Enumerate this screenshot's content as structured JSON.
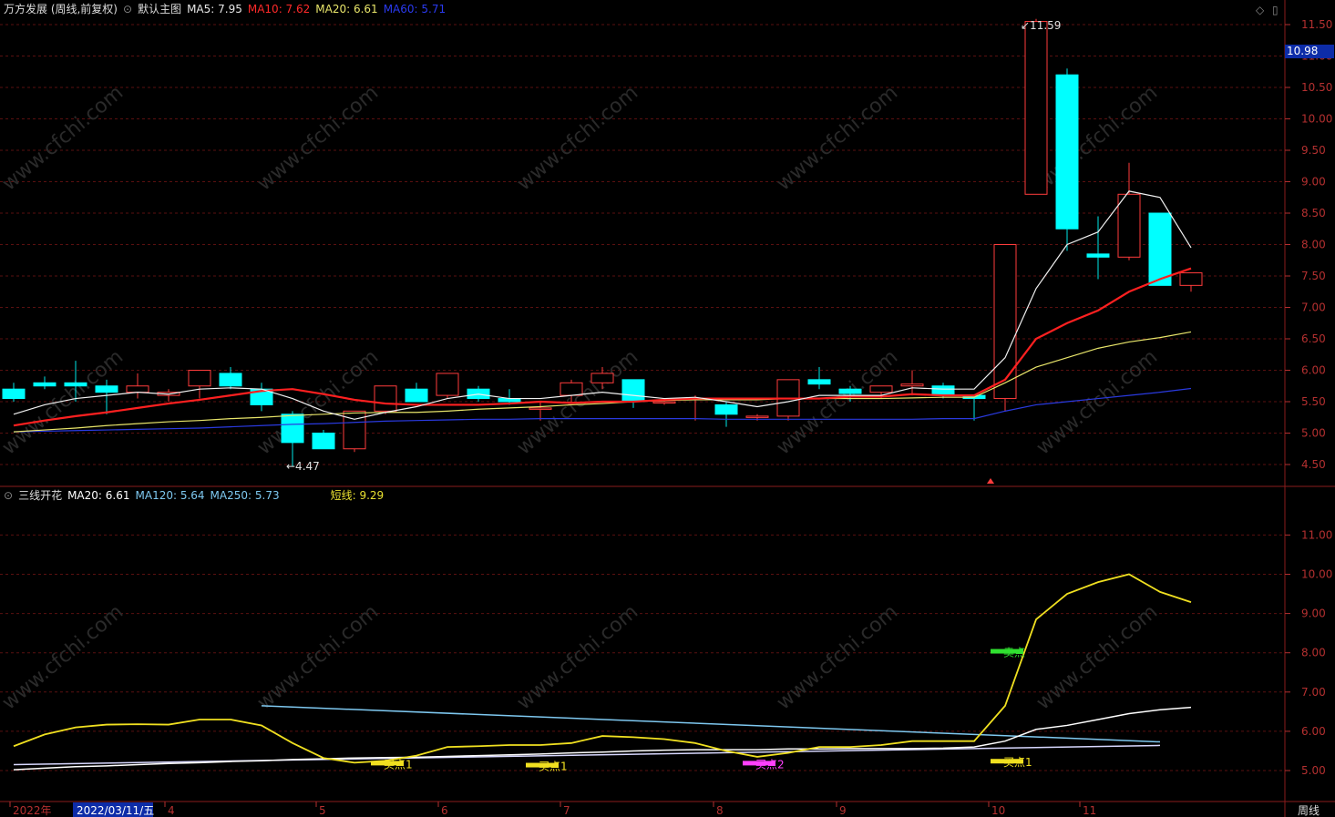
{
  "main_panel": {
    "stock_name": "万方发展 (周线,前复权)",
    "template": "默认主图",
    "ma5": {
      "label": "MA5: 7.95",
      "color": "#e8e8e8"
    },
    "ma10": {
      "label": "MA10: 7.62",
      "color": "#ff2a2a"
    },
    "ma20": {
      "label": "MA20: 6.61",
      "color": "#e8e56a"
    },
    "ma60": {
      "label": "MA60: 5.71",
      "color": "#1c2fd8"
    },
    "high_label": "11.59",
    "low_label": "4.47",
    "current_price": "10.98",
    "y_ticks": [
      "11.50",
      "11.00",
      "10.50",
      "10.00",
      "9.50",
      "9.00",
      "8.50",
      "8.00",
      "7.50",
      "7.00",
      "6.50",
      "6.00",
      "5.50",
      "5.00",
      "4.50"
    ]
  },
  "sub_panel": {
    "indicator": "三线开花",
    "ma20": "MA20: 6.61",
    "ma120": "MA120: 5.64",
    "ma250": "MA250: 5.73",
    "short": "短线: 9.29",
    "y_ticks": [
      "11.00",
      "10.00",
      "9.00",
      "8.00",
      "7.00",
      "6.00",
      "5.00"
    ],
    "signals": [
      "买点1",
      "买点1",
      "买点2",
      "卖点",
      "买点1"
    ]
  },
  "x_axis": {
    "labels": [
      "2022年",
      "2022/03/11/五",
      "4",
      "5",
      "6",
      "7",
      "8",
      "9",
      "10",
      "11"
    ],
    "period": "周线"
  },
  "watermark": "www.cfchi.com",
  "chart_data": {
    "type": "candlestick",
    "candles": [
      {
        "o": 5.7,
        "h": 5.8,
        "l": 5.5,
        "c": 5.55
      },
      {
        "o": 5.8,
        "h": 5.9,
        "l": 5.7,
        "c": 5.75
      },
      {
        "o": 5.8,
        "h": 6.15,
        "l": 5.5,
        "c": 5.75
      },
      {
        "o": 5.75,
        "h": 5.85,
        "l": 5.3,
        "c": 5.65
      },
      {
        "o": 5.65,
        "h": 5.95,
        "l": 5.55,
        "c": 5.75
      },
      {
        "o": 5.6,
        "h": 5.7,
        "l": 5.5,
        "c": 5.65
      },
      {
        "o": 5.75,
        "h": 6.0,
        "l": 5.55,
        "c": 6.0
      },
      {
        "o": 5.95,
        "h": 6.05,
        "l": 5.7,
        "c": 5.75
      },
      {
        "o": 5.7,
        "h": 5.8,
        "l": 5.35,
        "c": 5.45
      },
      {
        "o": 5.3,
        "h": 5.35,
        "l": 4.47,
        "c": 4.85
      },
      {
        "o": 5.0,
        "h": 5.05,
        "l": 4.75,
        "c": 4.75
      },
      {
        "o": 4.75,
        "h": 5.3,
        "l": 4.7,
        "c": 5.35
      },
      {
        "o": 5.35,
        "h": 5.75,
        "l": 5.3,
        "c": 5.75
      },
      {
        "o": 5.7,
        "h": 5.8,
        "l": 5.5,
        "c": 5.5
      },
      {
        "o": 5.6,
        "h": 5.95,
        "l": 5.55,
        "c": 5.95
      },
      {
        "o": 5.7,
        "h": 5.75,
        "l": 5.5,
        "c": 5.55
      },
      {
        "o": 5.55,
        "h": 5.7,
        "l": 5.45,
        "c": 5.5
      },
      {
        "o": 5.4,
        "h": 5.5,
        "l": 5.2,
        "c": 5.4
      },
      {
        "o": 5.6,
        "h": 5.85,
        "l": 5.5,
        "c": 5.8
      },
      {
        "o": 5.8,
        "h": 6.05,
        "l": 5.7,
        "c": 5.95
      },
      {
        "o": 5.85,
        "h": 5.85,
        "l": 5.4,
        "c": 5.5
      },
      {
        "o": 5.5,
        "h": 5.55,
        "l": 5.45,
        "c": 5.5
      },
      {
        "o": 5.55,
        "h": 5.6,
        "l": 5.2,
        "c": 5.55
      },
      {
        "o": 5.45,
        "h": 5.5,
        "l": 5.1,
        "c": 5.3
      },
      {
        "o": 5.25,
        "h": 5.3,
        "l": 5.2,
        "c": 5.27
      },
      {
        "o": 5.27,
        "h": 5.85,
        "l": 5.2,
        "c": 5.85
      },
      {
        "o": 5.85,
        "h": 6.05,
        "l": 5.7,
        "c": 5.78
      },
      {
        "o": 5.7,
        "h": 5.75,
        "l": 5.5,
        "c": 5.63
      },
      {
        "o": 5.65,
        "h": 5.75,
        "l": 5.55,
        "c": 5.75
      },
      {
        "o": 5.75,
        "h": 6.0,
        "l": 5.6,
        "c": 5.78
      },
      {
        "o": 5.75,
        "h": 5.8,
        "l": 5.55,
        "c": 5.6
      },
      {
        "o": 5.6,
        "h": 5.6,
        "l": 5.2,
        "c": 5.55
      },
      {
        "o": 5.55,
        "h": 8.0,
        "l": 5.35,
        "c": 8.0
      },
      {
        "o": 8.8,
        "h": 11.59,
        "l": 8.8,
        "c": 11.55
      },
      {
        "o": 10.7,
        "h": 10.8,
        "l": 7.9,
        "c": 8.25
      },
      {
        "o": 7.85,
        "h": 8.45,
        "l": 7.45,
        "c": 7.8
      },
      {
        "o": 7.8,
        "h": 9.3,
        "l": 7.75,
        "c": 8.8
      },
      {
        "o": 8.5,
        "h": 8.5,
        "l": 7.35,
        "c": 7.35
      },
      {
        "o": 7.35,
        "h": 7.55,
        "l": 7.25,
        "c": 7.55
      }
    ],
    "ma5": [
      5.3,
      5.45,
      5.55,
      5.6,
      5.65,
      5.62,
      5.7,
      5.72,
      5.7,
      5.55,
      5.35,
      5.22,
      5.33,
      5.42,
      5.55,
      5.62,
      5.55,
      5.55,
      5.6,
      5.65,
      5.6,
      5.55,
      5.57,
      5.5,
      5.42,
      5.5,
      5.6,
      5.6,
      5.6,
      5.72,
      5.7,
      5.7,
      6.2,
      7.3,
      8.0,
      8.2,
      8.85,
      8.75,
      7.95
    ],
    "ma10": [
      5.12,
      5.2,
      5.27,
      5.33,
      5.4,
      5.47,
      5.53,
      5.6,
      5.67,
      5.7,
      5.62,
      5.53,
      5.47,
      5.45,
      5.45,
      5.45,
      5.47,
      5.5,
      5.48,
      5.5,
      5.5,
      5.53,
      5.55,
      5.55,
      5.55,
      5.55,
      5.55,
      5.58,
      5.58,
      5.62,
      5.6,
      5.6,
      5.85,
      6.5,
      6.75,
      6.95,
      7.25,
      7.45,
      7.62
    ],
    "ma20": [
      5.02,
      5.05,
      5.08,
      5.12,
      5.15,
      5.18,
      5.2,
      5.23,
      5.25,
      5.28,
      5.3,
      5.32,
      5.33,
      5.33,
      5.35,
      5.38,
      5.4,
      5.42,
      5.45,
      5.47,
      5.5,
      5.52,
      5.53,
      5.53,
      5.53,
      5.55,
      5.55,
      5.55,
      5.55,
      5.56,
      5.57,
      5.57,
      5.8,
      6.05,
      6.2,
      6.35,
      6.45,
      6.52,
      6.61
    ],
    "ma60": [
      5.02,
      5.03,
      5.04,
      5.05,
      5.06,
      5.07,
      5.08,
      5.1,
      5.12,
      5.14,
      5.15,
      5.17,
      5.19,
      5.2,
      5.21,
      5.22,
      5.22,
      5.23,
      5.23,
      5.23,
      5.23,
      5.23,
      5.23,
      5.22,
      5.22,
      5.22,
      5.22,
      5.22,
      5.22,
      5.22,
      5.23,
      5.23,
      5.35,
      5.45,
      5.5,
      5.55,
      5.6,
      5.65,
      5.71
    ],
    "sub_short": [
      5.62,
      5.92,
      6.1,
      6.17,
      6.18,
      6.17,
      6.3,
      6.3,
      6.15,
      5.7,
      5.32,
      5.2,
      5.25,
      5.38,
      5.6,
      5.62,
      5.65,
      5.65,
      5.7,
      5.88,
      5.85,
      5.8,
      5.7,
      5.5,
      5.35,
      5.45,
      5.6,
      5.6,
      5.65,
      5.75,
      5.75,
      5.75,
      6.65,
      8.85,
      9.5,
      9.8,
      10.0,
      9.55,
      9.29
    ],
    "sub_ma20": [
      5.02,
      5.06,
      5.1,
      5.12,
      5.15,
      5.18,
      5.2,
      5.23,
      5.25,
      5.28,
      5.3,
      5.32,
      5.33,
      5.34,
      5.36,
      5.38,
      5.4,
      5.42,
      5.45,
      5.47,
      5.5,
      5.52,
      5.53,
      5.53,
      5.53,
      5.55,
      5.55,
      5.56,
      5.56,
      5.56,
      5.57,
      5.6,
      5.75,
      6.05,
      6.15,
      6.3,
      6.45,
      6.55,
      6.61
    ],
    "sub_ma120_points": [
      [
        8,
        6.65
      ],
      [
        37,
        5.73
      ]
    ],
    "sub_ma250_points": [
      [
        0,
        5.15
      ],
      [
        37,
        5.64
      ]
    ]
  }
}
